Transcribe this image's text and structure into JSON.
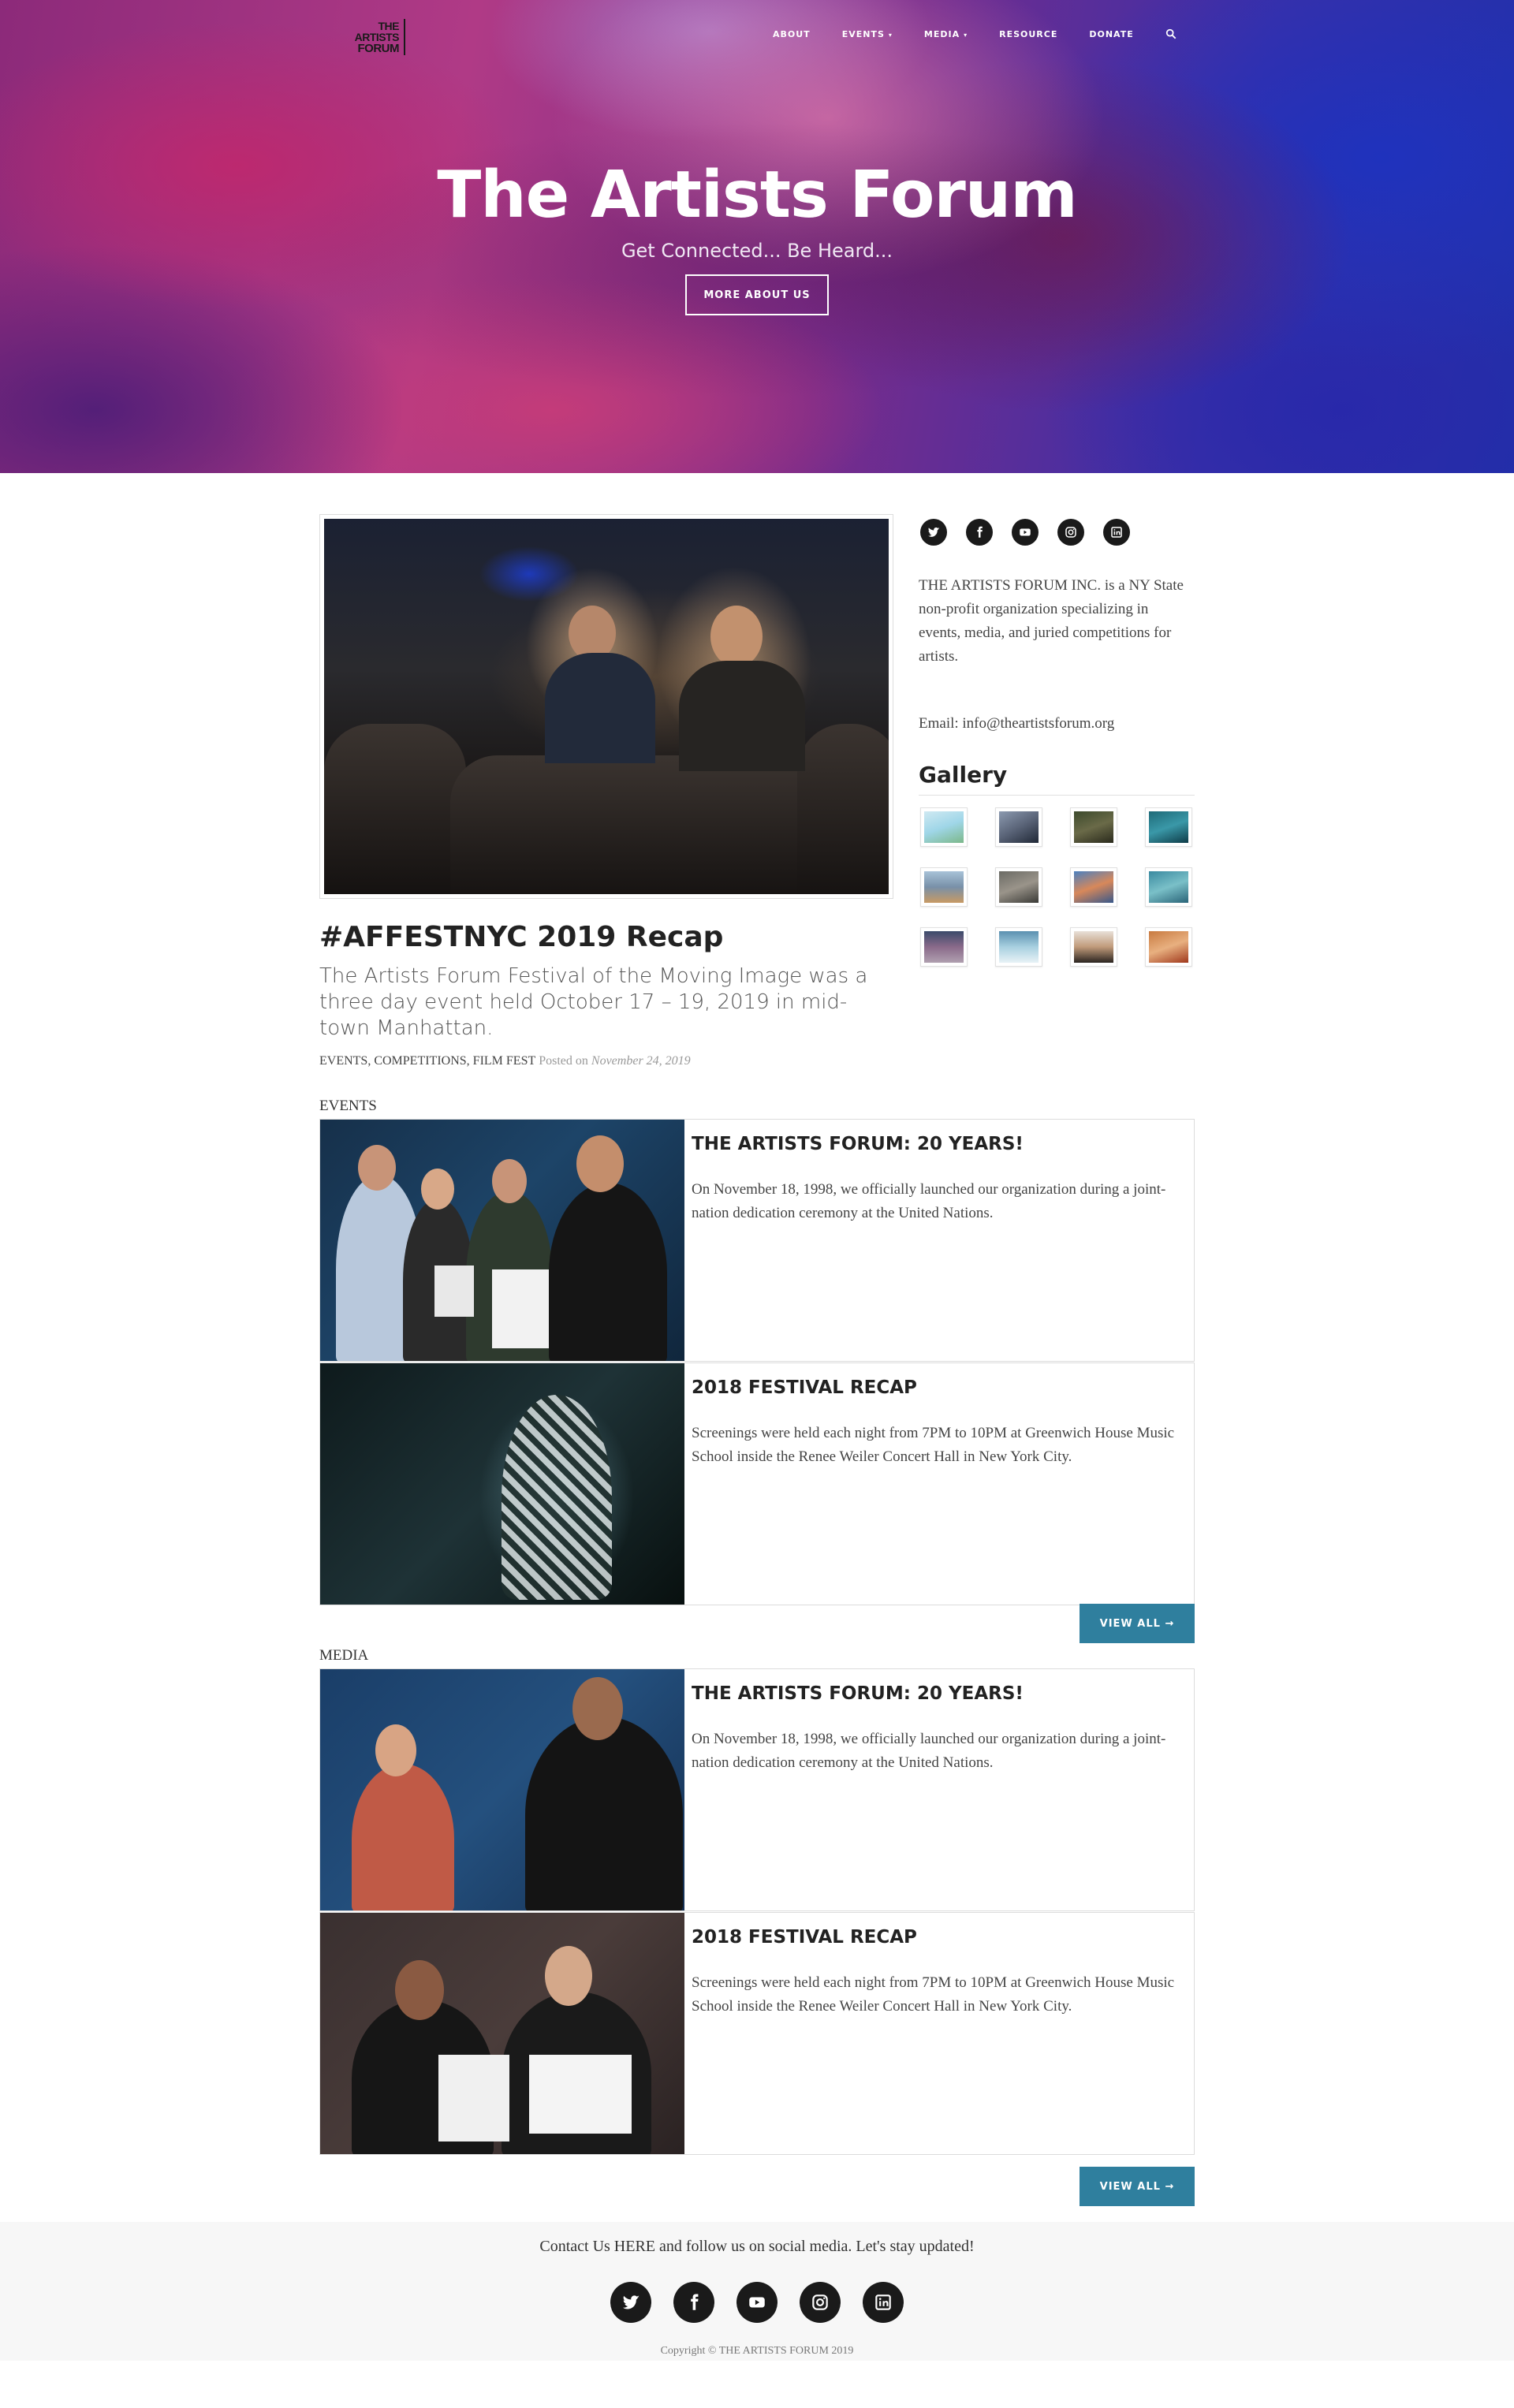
{
  "nav": {
    "logo": {
      "line1": "THE",
      "line2": "ARTISTS",
      "line3": "FORUM"
    },
    "items": [
      {
        "label": "ABOUT",
        "has_dropdown": false
      },
      {
        "label": "EVENTS",
        "has_dropdown": true
      },
      {
        "label": "MEDIA",
        "has_dropdown": true
      },
      {
        "label": "RESOURCE",
        "has_dropdown": false
      },
      {
        "label": "DONATE",
        "has_dropdown": false
      }
    ],
    "search_icon": "search-icon"
  },
  "hero": {
    "title": "The Artists Forum",
    "subtitle": "Get Connected... Be Heard...",
    "button": "MORE ABOUT US"
  },
  "featured": {
    "title": "#AFFESTNYC 2019 Recap",
    "description": "The Artists Forum Festival of the Moving Image was a three day event held October 17 – 19, 2019 in mid-town Manhattan.",
    "categories": "EVENTS, COMPETITIONS, FILM FEST",
    "posted_label": "Posted on",
    "posted_date": "November 24, 2019"
  },
  "sidebar": {
    "social": [
      "twitter-icon",
      "facebook-icon",
      "youtube-icon",
      "instagram-icon",
      "linkedin-icon"
    ],
    "about": "THE ARTISTS FORUM INC. is a NY State non-profit organization specializing in events, media, and juried competitions for artists.",
    "email": "Email: info@theartistsforum.org",
    "gallery_title": "Gallery"
  },
  "events": {
    "label": "EVENTS",
    "posts": [
      {
        "title": "THE ARTISTS FORUM: 20 YEARS!",
        "text": "On November 18, 1998, we officially launched our organization during a joint-nation dedication ceremony at the United Nations."
      },
      {
        "title": "2018 FESTIVAL RECAP",
        "text": "Screenings were held each night from 7PM to 10PM at Greenwich House Music School inside the Renee Weiler Concert Hall in New York City."
      }
    ],
    "view_all": "VIEW ALL →"
  },
  "media": {
    "label": "MEDIA",
    "posts": [
      {
        "title": "THE ARTISTS FORUM: 20 YEARS!",
        "text": "On November 18, 1998, we officially launched our organization during a joint-nation dedication ceremony at the United Nations."
      },
      {
        "title": "2018 FESTIVAL RECAP",
        "text": "Screenings were held each night from 7PM to 10PM at Greenwich House Music School inside the Renee Weiler Concert Hall in New York City."
      }
    ],
    "view_all": "VIEW ALL →"
  },
  "footer": {
    "text": "Contact Us HERE and follow us on social media. Let's stay updated!",
    "social": [
      "twitter-icon",
      "facebook-icon",
      "youtube-icon",
      "instagram-icon",
      "linkedin-icon"
    ],
    "copyright": "Copyright © THE ARTISTS FORUM 2019"
  },
  "colors": {
    "accent_button": "#2f7f9e",
    "dark_icon": "#1a1a1a"
  }
}
